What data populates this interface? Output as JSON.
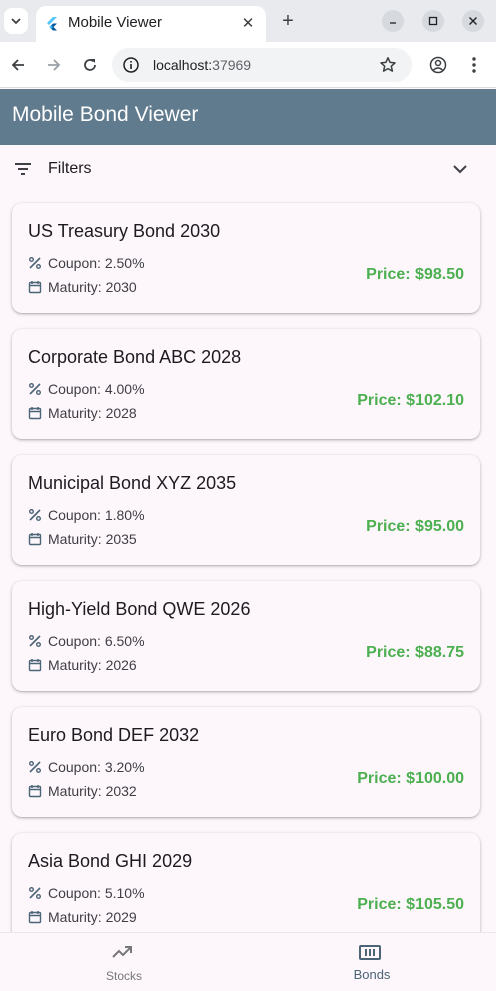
{
  "browser": {
    "tab_title": "Mobile Viewer",
    "url_host": "localhost:",
    "url_port": "37969"
  },
  "app": {
    "title": "Mobile Bond Viewer",
    "filters_label": "Filters"
  },
  "bonds": [
    {
      "name": "US Treasury Bond 2030",
      "coupon": "Coupon: 2.50%",
      "maturity": "Maturity: 2030",
      "price": "Price: $98.50"
    },
    {
      "name": "Corporate Bond ABC 2028",
      "coupon": "Coupon: 4.00%",
      "maturity": "Maturity: 2028",
      "price": "Price: $102.10"
    },
    {
      "name": "Municipal Bond XYZ 2035",
      "coupon": "Coupon: 1.80%",
      "maturity": "Maturity: 2035",
      "price": "Price: $95.00"
    },
    {
      "name": "High-Yield Bond QWE 2026",
      "coupon": "Coupon: 6.50%",
      "maturity": "Maturity: 2026",
      "price": "Price: $88.75"
    },
    {
      "name": "Euro Bond DEF 2032",
      "coupon": "Coupon: 3.20%",
      "maturity": "Maturity: 2032",
      "price": "Price: $100.00"
    },
    {
      "name": "Asia Bond GHI 2029",
      "coupon": "Coupon: 5.10%",
      "maturity": "Maturity: 2029",
      "price": "Price: $105.50"
    }
  ],
  "bottom_nav": {
    "stocks_label": "Stocks",
    "bonds_label": "Bonds",
    "selected": "Bonds"
  },
  "colors": {
    "app_bar": "#607a8e",
    "price": "#4caf50",
    "background": "#fdf7fc"
  }
}
